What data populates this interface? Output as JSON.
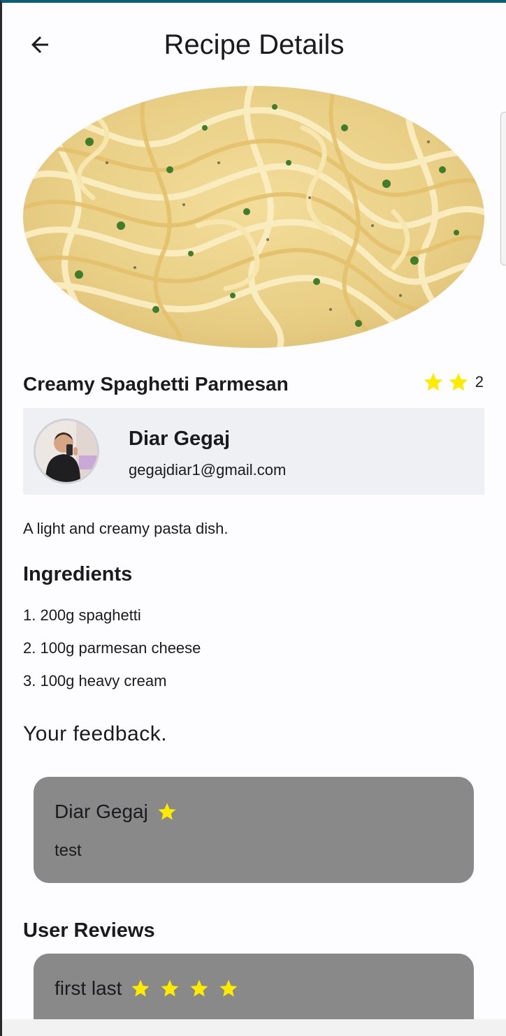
{
  "header": {
    "title": "Recipe Details",
    "back_icon": "arrow-left-icon"
  },
  "recipe": {
    "title": "Creamy Spaghetti Parmesan",
    "rating_count": "2",
    "rating_stars": 2,
    "description": "A light and creamy pasta dish.",
    "image_alt": "pasta-photo"
  },
  "author": {
    "name": "Diar Gegaj",
    "email": "gegajdiar1@gmail.com"
  },
  "ingredients": {
    "title": "Ingredients",
    "items": [
      "1. 200g spaghetti",
      "2. 100g parmesan cheese",
      "3. 100g heavy cream"
    ]
  },
  "feedback": {
    "title": "Your feedback.",
    "review": {
      "name": "Diar Gegaj",
      "stars": 1,
      "text": "test"
    }
  },
  "user_reviews": {
    "title": "User Reviews",
    "items": [
      {
        "name": "first last",
        "stars": 4
      }
    ]
  },
  "colors": {
    "star": "#ffeb00",
    "card_bg": "#898989",
    "author_bg": "#eff0f3",
    "status_accent": "#0b5d73"
  }
}
